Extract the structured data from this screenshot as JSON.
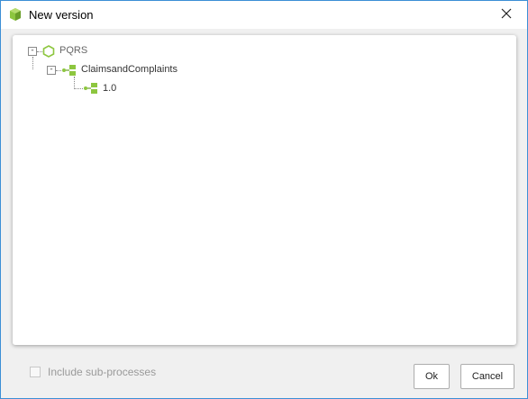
{
  "window": {
    "title": "New version",
    "app_icon": "green-cube-icon",
    "close_icon": "close-icon"
  },
  "tree": {
    "root": {
      "label": "PQRS",
      "expander": "-",
      "icon": "hexagon-icon",
      "children": [
        {
          "label": "ClaimsandComplaints",
          "expander": "-",
          "icon": "process-icon",
          "children": [
            {
              "label": "1.0",
              "icon": "process-version-icon"
            }
          ]
        }
      ]
    }
  },
  "footer": {
    "include_subprocesses_label": "Include sub-processes",
    "include_subprocesses_checked": false,
    "include_subprocesses_enabled": false,
    "ok_label": "Ok",
    "cancel_label": "Cancel"
  },
  "colors": {
    "accent_green": "#8dc63f",
    "window_border": "#3c8fd6",
    "background": "#f0f0f0"
  }
}
